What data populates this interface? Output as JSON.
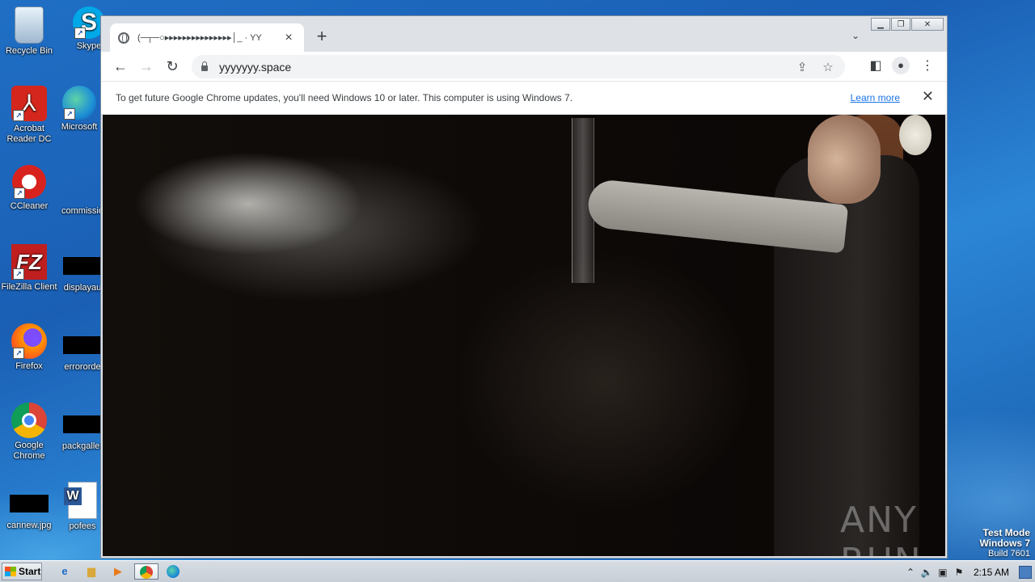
{
  "desktop": {
    "icons": [
      {
        "label": "Recycle Bin",
        "icon": "recycle-bin-icon"
      },
      {
        "label": "Skype",
        "icon": "skype-icon"
      },
      {
        "label": "Acrobat Reader DC",
        "icon": "acrobat-icon"
      },
      {
        "label": "Microsoft",
        "icon": "edge-icon"
      },
      {
        "label": "CCleaner",
        "icon": "ccleaner-icon"
      },
      {
        "label": "commissio",
        "icon": "file-icon"
      },
      {
        "label": "FileZilla Client",
        "icon": "filezilla-icon"
      },
      {
        "label": "displayau",
        "icon": "file-icon"
      },
      {
        "label": "Firefox",
        "icon": "firefox-icon"
      },
      {
        "label": "errororde",
        "icon": "file-icon"
      },
      {
        "label": "Google Chrome",
        "icon": "chrome-icon"
      },
      {
        "label": "packgaller",
        "icon": "file-icon"
      },
      {
        "label": "cannew.jpg",
        "icon": "image-file-icon"
      },
      {
        "label": "pofees",
        "icon": "word-icon"
      }
    ]
  },
  "browser": {
    "tab_title": "(─┬─○▸▸▸▸▸▸▸▸▸▸▸▸▸▸▸│_ · YY",
    "url": "yyyyyyy.space",
    "infobar_text": "To get future Google Chrome updates, you'll need Windows 10 or later. This computer is using Windows 7.",
    "infobar_link": "Learn more"
  },
  "content": {
    "watermark": "ANY RUN"
  },
  "testmode": {
    "line1": "Test Mode",
    "line2": "Windows 7",
    "line3": "Build 7601"
  },
  "taskbar": {
    "start_label": "Start",
    "clock": "2:15 AM"
  }
}
